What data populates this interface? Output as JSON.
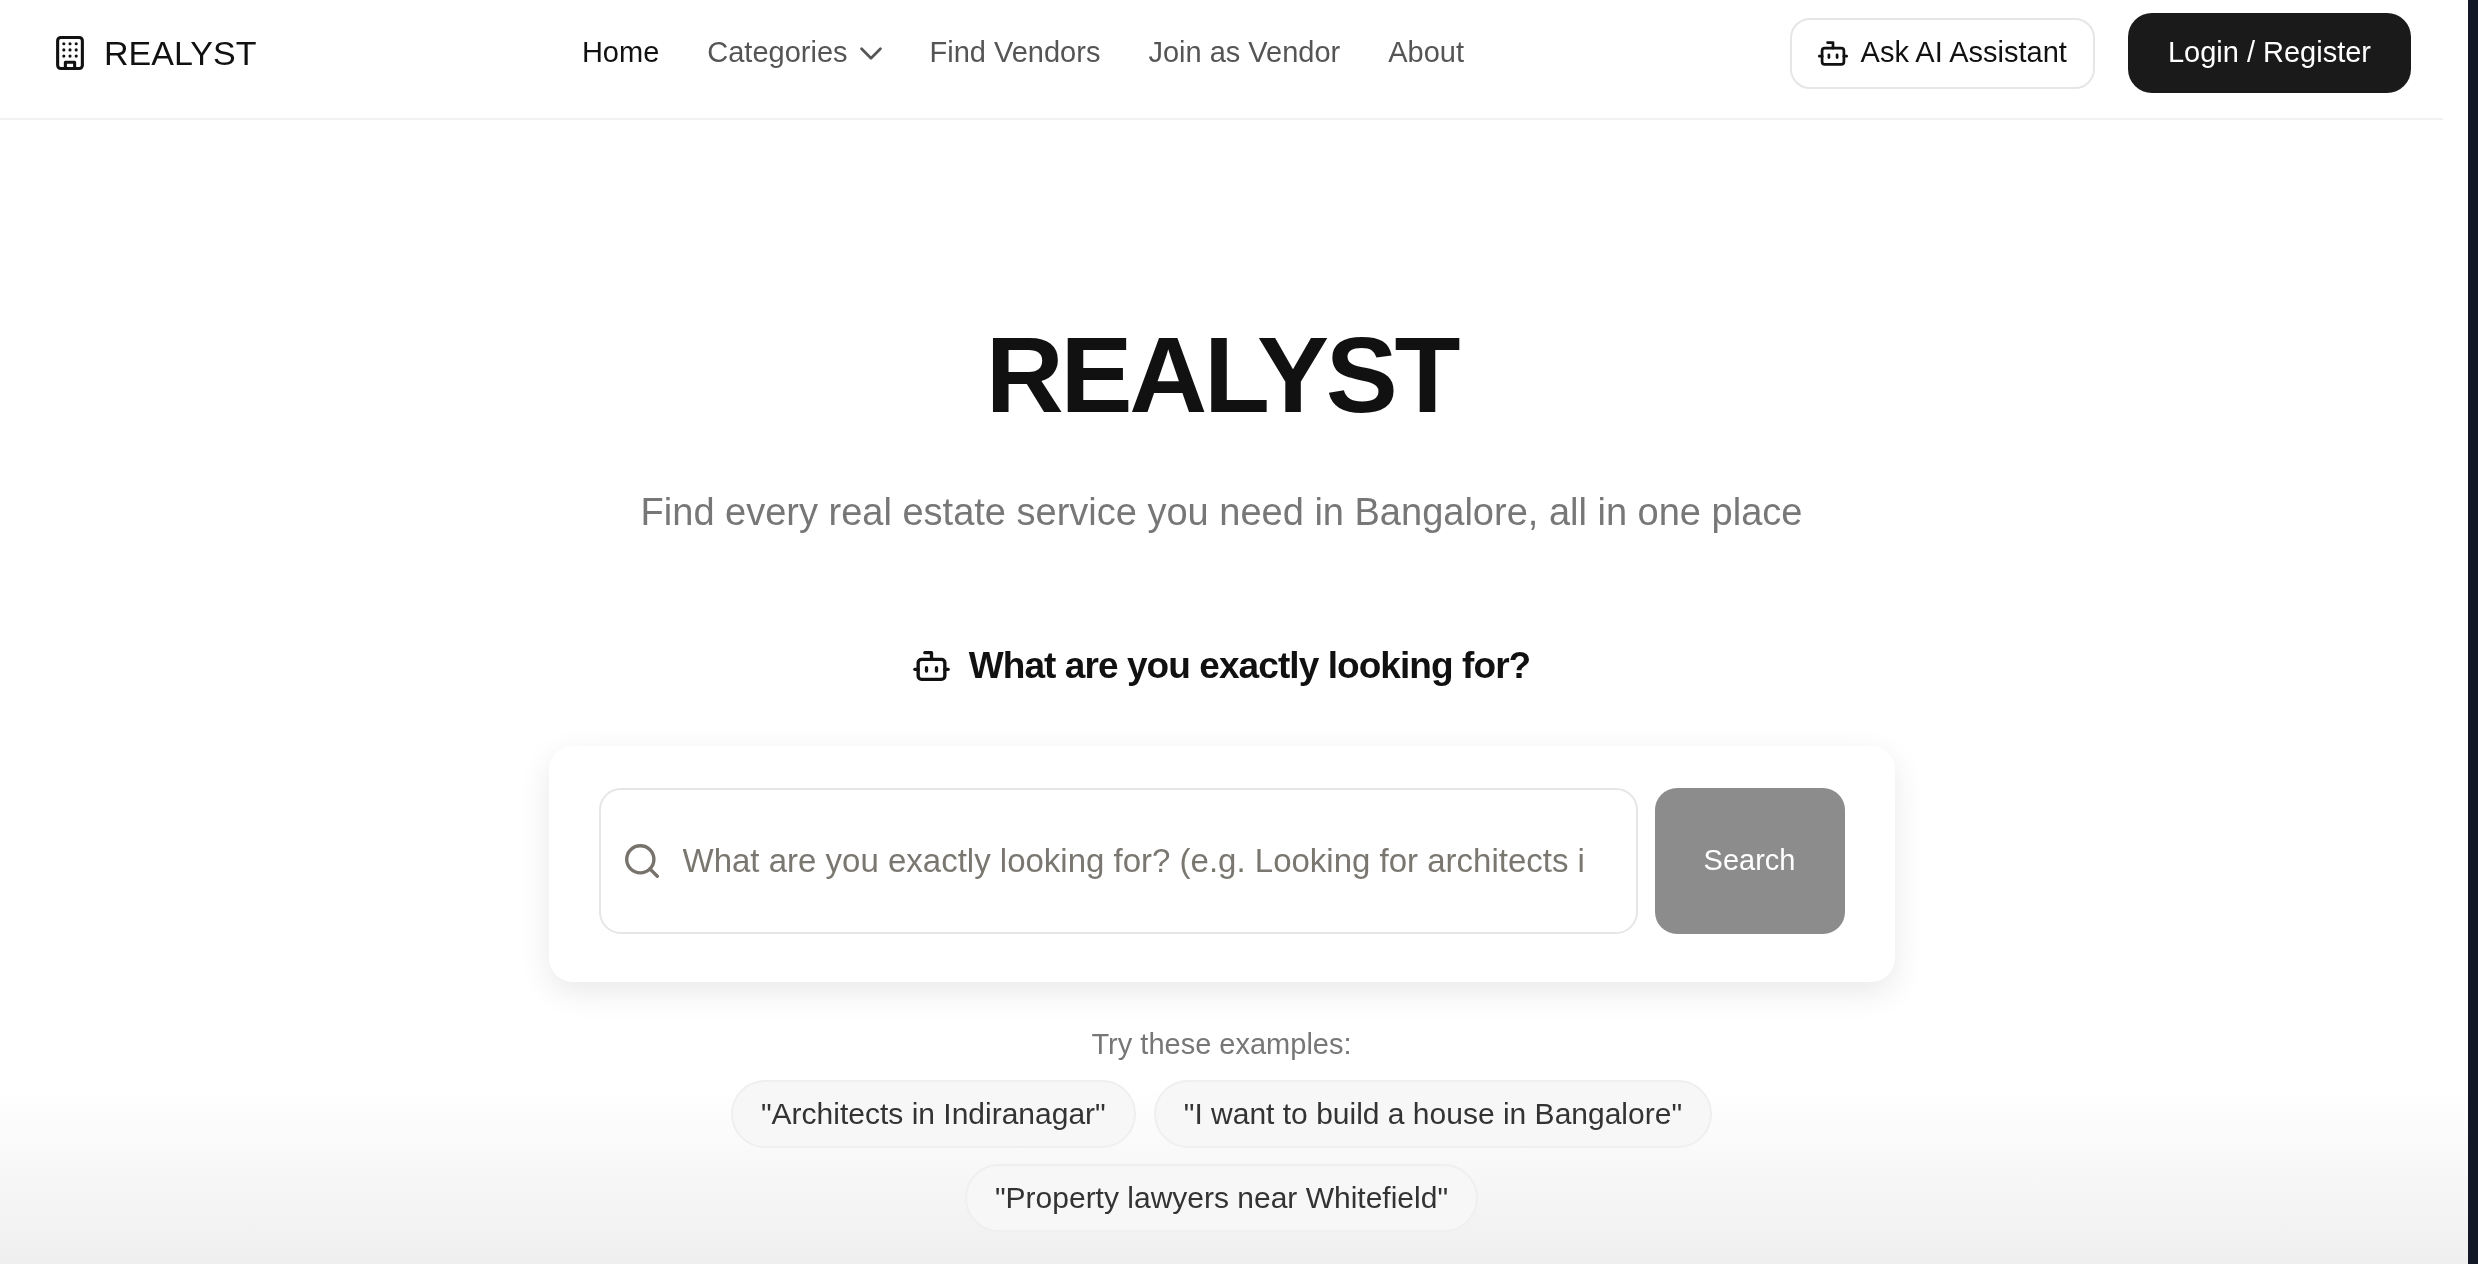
{
  "header": {
    "logo": "REALYST",
    "nav": [
      {
        "label": "Home",
        "selected": true,
        "dropdown": false
      },
      {
        "label": "Categories",
        "selected": false,
        "dropdown": true
      },
      {
        "label": "Find Vendors",
        "selected": false,
        "dropdown": false
      },
      {
        "label": "Join as Vendor",
        "selected": false,
        "dropdown": false
      },
      {
        "label": "About",
        "selected": false,
        "dropdown": false
      }
    ],
    "actions": [
      {
        "kind": "outline",
        "label": "Ask AI Assistant"
      },
      {
        "kind": "solid",
        "label": "Login / Register"
      }
    ]
  },
  "hero": {
    "title": "REALYST",
    "subtitle": "Find every real estate service you need in Bangalore, all in one place",
    "prompt": "What are you exactly looking for?"
  },
  "search": {
    "placeholder": "What are you exactly looking for? (e.g. Looking for architects i",
    "button": {
      "label": "Search",
      "disabled": true
    }
  },
  "examples": {
    "label": "Try these examples:",
    "chips": [
      "\"Architects in Indiranagar\"",
      "\"I want to build a house in Bangalore\"",
      "\"Property lawyers near Whitefield\""
    ]
  }
}
